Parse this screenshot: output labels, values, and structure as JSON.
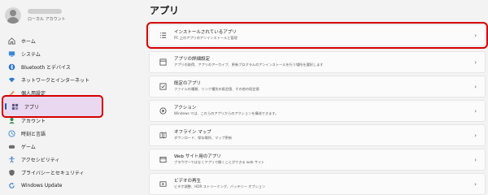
{
  "account": {
    "type": "ローカル アカウント"
  },
  "sidebar": {
    "items": [
      {
        "label": "ホーム",
        "icon": "home-icon"
      },
      {
        "label": "システム",
        "icon": "system-icon"
      },
      {
        "label": "Bluetooth とデバイス",
        "icon": "bluetooth-icon"
      },
      {
        "label": "ネットワークとインターネット",
        "icon": "network-icon"
      },
      {
        "label": "個人用設定",
        "icon": "personalization-icon"
      },
      {
        "label": "アプリ",
        "icon": "apps-icon"
      },
      {
        "label": "アカウント",
        "icon": "account-icon"
      },
      {
        "label": "時刻と言語",
        "icon": "time-language-icon"
      },
      {
        "label": "ゲーム",
        "icon": "gaming-icon"
      },
      {
        "label": "アクセシビリティ",
        "icon": "accessibility-icon"
      },
      {
        "label": "プライバシーとセキュリティ",
        "icon": "privacy-icon"
      },
      {
        "label": "Windows Update",
        "icon": "windows-update-icon"
      }
    ]
  },
  "main": {
    "title": "アプリ",
    "cards": [
      {
        "title": "インストールされているアプリ",
        "subtitle": "PC 上のアプリのアンインストールと管理",
        "icon": "list-icon"
      },
      {
        "title": "アプリの詳細設定",
        "subtitle": "アプリの取得、アプリのアーカイブ、更新プログラムのアンインストールを行う場所を選択します",
        "icon": "app-settings-icon"
      },
      {
        "title": "既定のアプリ",
        "subtitle": "ファイルの種類、リンク種別の既定値、その他の既定値",
        "icon": "default-apps-icon"
      },
      {
        "title": "アクション",
        "subtitle": "Windows では、これらのアプリからのアクションを構成できます。",
        "icon": "action-icon"
      },
      {
        "title": "オフライン マップ",
        "subtitle": "ダウンロード、保存場所、マップ更新",
        "icon": "map-icon"
      },
      {
        "title": "Web サイト用のアプリ",
        "subtitle": "ブラウザーではなくアプリで開くことができる web サイト",
        "icon": "web-apps-icon"
      },
      {
        "title": "ビデオの再生",
        "subtitle": "ビデオ調整、HDR ストリーミング、バッテリー オプション",
        "icon": "video-icon"
      }
    ]
  }
}
